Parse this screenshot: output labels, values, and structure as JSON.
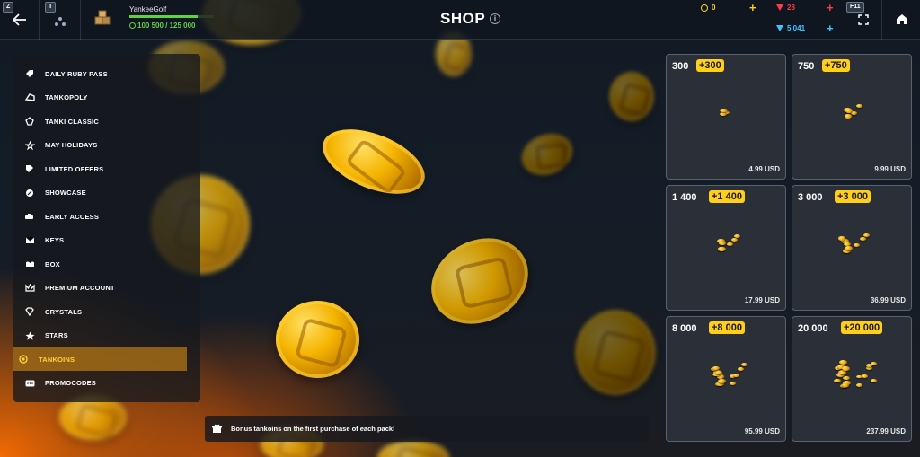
{
  "header": {
    "back_hotkey": "Z",
    "tank_hotkey": "T",
    "username": "YankeeGolf",
    "xp_text": "100 500 / 125 000",
    "xp_progress": 0.804,
    "title": "SHOP",
    "info": "i",
    "resources": {
      "tankoins": "0",
      "rubies": "28",
      "crystals": "5 041"
    },
    "fullscreen_hotkey": "F11"
  },
  "sidebar": {
    "items": [
      {
        "label": "DAILY RUBY PASS",
        "icon": "ruby-pass-icon"
      },
      {
        "label": "TANKOPOLY",
        "icon": "tankopoly-icon"
      },
      {
        "label": "TANKI CLASSIC",
        "icon": "classic-icon"
      },
      {
        "label": "MAY HOLIDAYS",
        "icon": "holiday-icon"
      },
      {
        "label": "LIMITED OFFERS",
        "icon": "limited-offers-icon"
      },
      {
        "label": "SHOWCASE",
        "icon": "showcase-icon"
      },
      {
        "label": "EARLY ACCESS",
        "icon": "early-access-icon"
      },
      {
        "label": "KEYS",
        "icon": "keys-icon"
      },
      {
        "label": "BOX",
        "icon": "box-icon"
      },
      {
        "label": "PREMIUM ACCOUNT",
        "icon": "premium-icon"
      },
      {
        "label": "CRYSTALS",
        "icon": "crystal-icon"
      },
      {
        "label": "STARS",
        "icon": "star-icon"
      },
      {
        "label": "TANKOINS",
        "icon": "tankoin-icon"
      },
      {
        "label": "PROMOCODES",
        "icon": "promocode-icon"
      }
    ],
    "active_index": 12
  },
  "notice": {
    "text": "Bonus tankoins on the first purchase of each pack!"
  },
  "packs": [
    {
      "amount": "300",
      "bonus": "+300",
      "price": "4.99 USD"
    },
    {
      "amount": "750",
      "bonus": "+750",
      "price": "9.99 USD"
    },
    {
      "amount": "1 400",
      "bonus": "+1 400",
      "price": "17.99 USD"
    },
    {
      "amount": "3 000",
      "bonus": "+3 000",
      "price": "36.99 USD"
    },
    {
      "amount": "8 000",
      "bonus": "+8 000",
      "price": "95.99 USD"
    },
    {
      "amount": "20 000",
      "bonus": "+20 000",
      "price": "237.99 USD"
    }
  ],
  "colors": {
    "accent_gold": "#ffcf1a",
    "xp_green": "#5fd23d",
    "ruby_red": "#ff3b4a",
    "crystal_blue": "#3fc4ff",
    "active_item": "#ffd23c"
  }
}
